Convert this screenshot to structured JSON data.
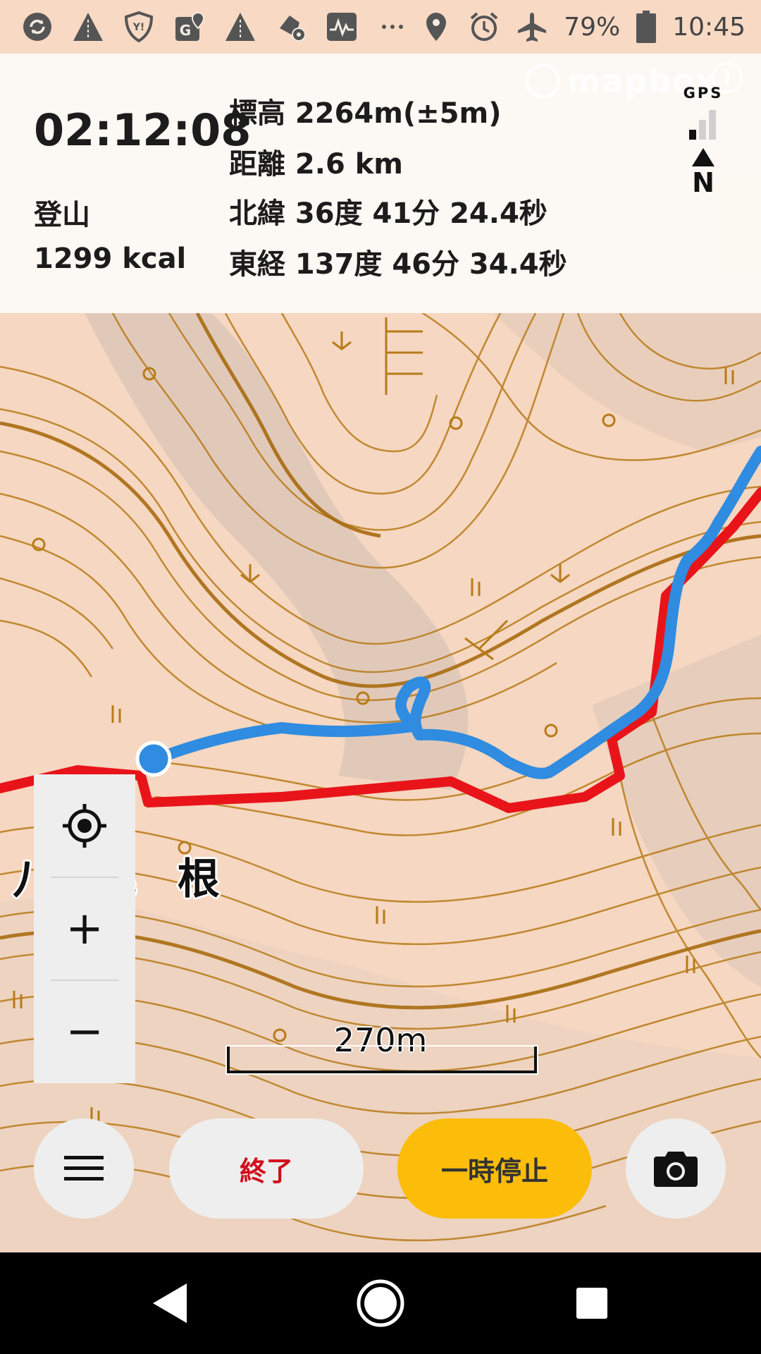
{
  "status_bar": {
    "left_icons": [
      "sync-icon",
      "road-warning-icon",
      "yahoo-shield-icon",
      "google-maps-icon",
      "road-warning-icon",
      "settings-app-icon",
      "activity-icon",
      "more-icon"
    ],
    "battery_percent": "79%",
    "time": "10:45",
    "right_icons": [
      "location-icon",
      "alarm-icon",
      "airplane-mode-icon",
      "battery-icon"
    ]
  },
  "tracking": {
    "elapsed_time": "02:12:08",
    "activity_type": "登山",
    "calories": "1299 kcal",
    "altitude": "標高 2264m(±5m)",
    "distance": "距離 2.6 km",
    "latitude": "北緯 36度 41分 24.4秒",
    "longitude": "東経 137度 46分 34.4秒"
  },
  "gps": {
    "label": "GPS",
    "signal_bars_active": 1,
    "signal_bars_total": 3
  },
  "compass": {
    "label": "N"
  },
  "map": {
    "attribution": "mapbox",
    "info_label": "i",
    "place_label": "八 尾 根",
    "scale_label": "270m",
    "route_color": "#e8141a",
    "track_color": "#2f8ce0",
    "contour_color": "#b77b19",
    "background_color": "#f7d9c4"
  },
  "zoom_controls": {
    "locate_icon": "crosshair-icon",
    "zoom_in_label": "+",
    "zoom_out_label": "−"
  },
  "actions": {
    "menu_icon": "hamburger-menu-icon",
    "end_label": "終了",
    "pause_label": "一時停止",
    "camera_icon": "camera-icon"
  },
  "nav_bar": {
    "back_icon": "back-triangle-icon",
    "home_icon": "home-circle-icon",
    "recents_icon": "recents-square-icon"
  }
}
